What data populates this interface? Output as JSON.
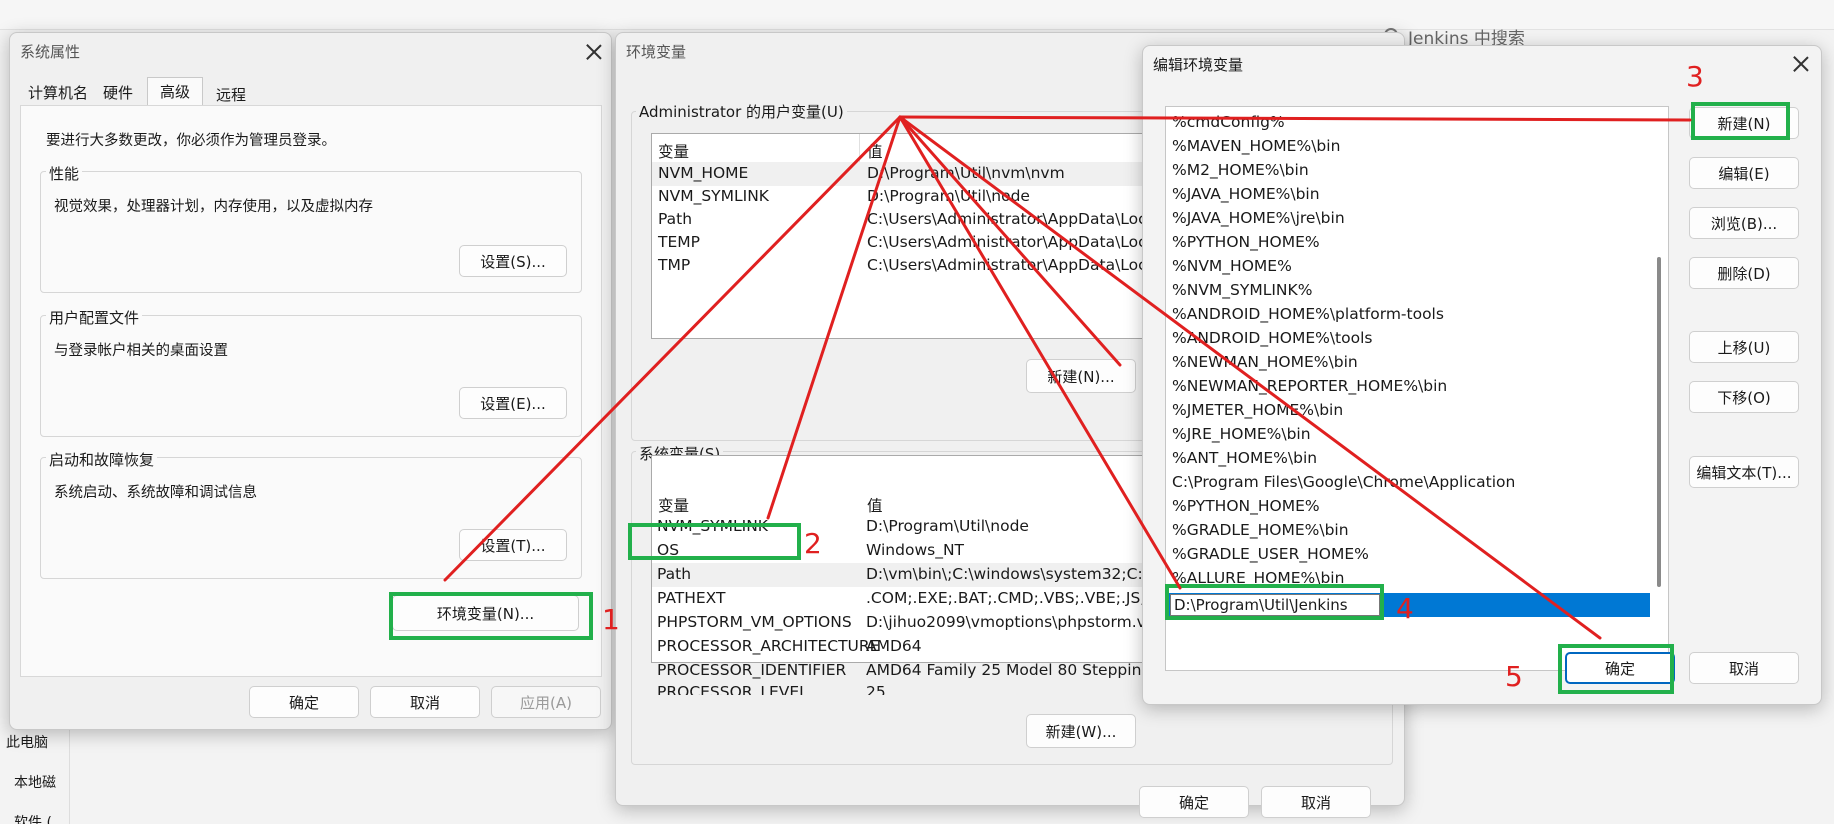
{
  "background": {
    "search_placeholder": "Jenkins 中搜索",
    "explorer_items": [
      "此电脑",
      "本地磁",
      "软件 ("
    ]
  },
  "sys_props": {
    "title": "系统属性",
    "tabs": [
      "计算机名",
      "硬件",
      "高级",
      "远程"
    ],
    "active_tab": "高级",
    "notice": "要进行大多数更改，你必须作为管理员登录。",
    "groups": [
      {
        "label": "性能",
        "desc": "视觉效果，处理器计划，内存使用，以及虚拟内存",
        "button": "设置(S)..."
      },
      {
        "label": "用户配置文件",
        "desc": "与登录帐户相关的桌面设置",
        "button": "设置(E)..."
      },
      {
        "label": "启动和故障恢复",
        "desc": "系统启动、系统故障和调试信息",
        "button": "设置(T)..."
      }
    ],
    "env_button": "环境变量(N)...",
    "ok": "确定",
    "cancel": "取消",
    "apply": "应用(A)"
  },
  "env_vars": {
    "title": "环境变量",
    "user_section": "Administrator 的用户变量(U)",
    "col_var": "变量",
    "col_val": "值",
    "user_rows": [
      {
        "name": "NVM_HOME",
        "value": "D:\\Program\\Util\\nvm\\nvm"
      },
      {
        "name": "NVM_SYMLINK",
        "value": "D:\\Program\\Util\\node"
      },
      {
        "name": "Path",
        "value": "C:\\Users\\Administrator\\AppData\\Loc"
      },
      {
        "name": "TEMP",
        "value": "C:\\Users\\Administrator\\AppData\\Loc"
      },
      {
        "name": "TMP",
        "value": "C:\\Users\\Administrator\\AppData\\Loc"
      }
    ],
    "user_new": "新建(N)...",
    "sys_section": "系统变量(S)",
    "sys_rows": [
      {
        "name": "NVM_SYMLINK",
        "value": "D:\\Program\\Util\\node"
      },
      {
        "name": "OS",
        "value": "Windows_NT"
      },
      {
        "name": "Path",
        "value": "D:\\vm\\bin\\;C:\\windows\\system32;C:\\"
      },
      {
        "name": "PATHEXT",
        "value": ".COM;.EXE;.BAT;.CMD;.VBS;.VBE;.JS;.JS"
      },
      {
        "name": "PHPSTORM_VM_OPTIONS",
        "value": "D:\\jihuo2099\\vmoptions\\phpstorm.v"
      },
      {
        "name": "PROCESSOR_ARCHITECTURE",
        "value": "AMD64"
      },
      {
        "name": "PROCESSOR_IDENTIFIER",
        "value": "AMD64 Family 25 Model 80 Stepping"
      },
      {
        "name": "PROCESSOR_LEVEL",
        "value": "25"
      }
    ],
    "sys_new": "新建(W)...",
    "ok": "确定",
    "cancel": "取消"
  },
  "edit_env": {
    "title": "编辑环境变量",
    "entries": [
      "%cmdConfig%",
      "%MAVEN_HOME%\\bin",
      "%M2_HOME%\\bin",
      "%JAVA_HOME%\\bin",
      "%JAVA_HOME%\\jre\\bin",
      "%PYTHON_HOME%",
      "%NVM_HOME%",
      "%NVM_SYMLINK%",
      "%ANDROID_HOME%\\platform-tools",
      "%ANDROID_HOME%\\tools",
      "%NEWMAN_HOME%\\bin",
      "%NEWMAN_REPORTER_HOME%\\bin",
      "%JMETER_HOME%\\bin",
      "%JRE_HOME%\\bin",
      "%ANT_HOME%\\bin",
      "C:\\Program Files\\Google\\Chrome\\Application",
      "%PYTHON_HOME%",
      "%GRADLE_HOME%\\bin",
      "%GRADLE_USER_HOME%",
      "%ALLURE_HOME%\\bin"
    ],
    "editing_value": "D:\\Program\\Util\\Jenkins",
    "buttons": [
      "新建(N)",
      "编辑(E)",
      "浏览(B)...",
      "删除(D)",
      "上移(U)",
      "下移(O)",
      "编辑文本(T)..."
    ],
    "ok": "确定",
    "cancel": "取消"
  },
  "annotations": {
    "steps": [
      "1",
      "2",
      "3",
      "4",
      "5"
    ],
    "arrow_color": "#e02020",
    "highlight_color": "#22b04b"
  }
}
